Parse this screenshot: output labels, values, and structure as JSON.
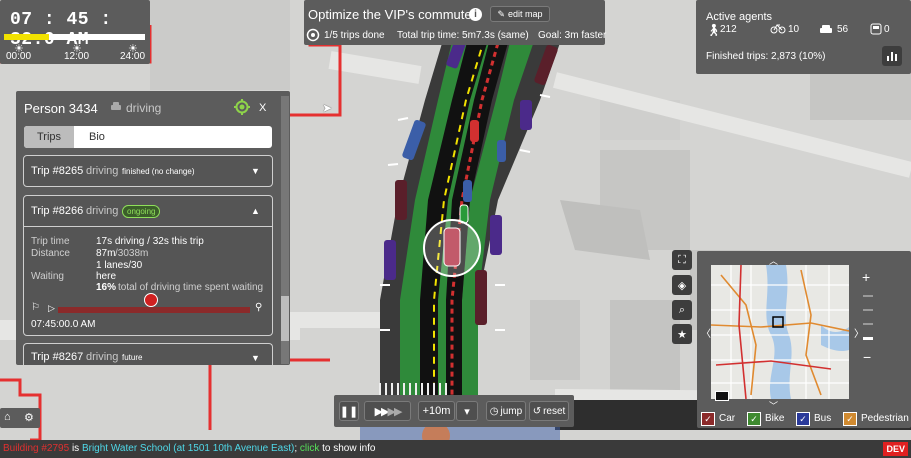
{
  "clock": {
    "time": "07 : 45 : 32.0 AM",
    "ticks": [
      "00:00",
      "12:00",
      "24:00"
    ],
    "progress": 0.32
  },
  "challenge": {
    "title": "Optimize the VIP's commute",
    "edit_label": "edit map",
    "trips_done": "1/5 trips done",
    "total_trip_time": "Total trip time: 5m7.3s (same)",
    "goal": "Goal: 3m faster"
  },
  "agents": {
    "title": "Active agents",
    "pedestrians": "212",
    "bikes": "10",
    "cars": "56",
    "buses": "0",
    "finished": "Finished trips: 2,873 (10%)"
  },
  "person": {
    "title": "Person 3434",
    "mode": "driving",
    "close": "X",
    "tabs": [
      "Trips",
      "Bio"
    ],
    "trip1": {
      "name": "Trip #8265",
      "mode": "driving",
      "status": "finished (no change)"
    },
    "trip2": {
      "name": "Trip #8266",
      "mode": "driving",
      "status": "ongoing",
      "trip_time_label": "Trip time",
      "trip_time": "17s driving / 32s this trip",
      "distance_label": "Distance",
      "distance_main": "87m",
      "distance_total": "/3038m",
      "lanes": "1 lanes/30",
      "waiting_label": "Waiting",
      "waiting_where": "here",
      "waiting_pct": "16%",
      "waiting_rest": "total of driving time spent waiting",
      "start_time": "07:45:00.0 AM"
    },
    "trip3": {
      "name": "Trip #8267",
      "mode": "driving",
      "status": "future"
    }
  },
  "speed": {
    "step": "+10m",
    "jump": "jump",
    "reset": "reset"
  },
  "legend": {
    "car": "Car",
    "bike": "Bike",
    "bus": "Bus",
    "pedestrian": "Pedestrian"
  },
  "minimap": {
    "badge": "DEV"
  },
  "status": {
    "building": "Building #2795",
    "is": " is ",
    "name": "Bright Water School (at 1501 10th Avenue East)",
    "sep": ";",
    "click": "click",
    "rest": " to show info",
    "dev": "DEV"
  },
  "colors": {
    "panel": "#5c5c5c",
    "road_green": "#2e8b3a",
    "accent_yellow": "#f2e200",
    "status_red": "#e03030",
    "status_cyan": "#4fd8e8",
    "status_green": "#57e05a"
  }
}
